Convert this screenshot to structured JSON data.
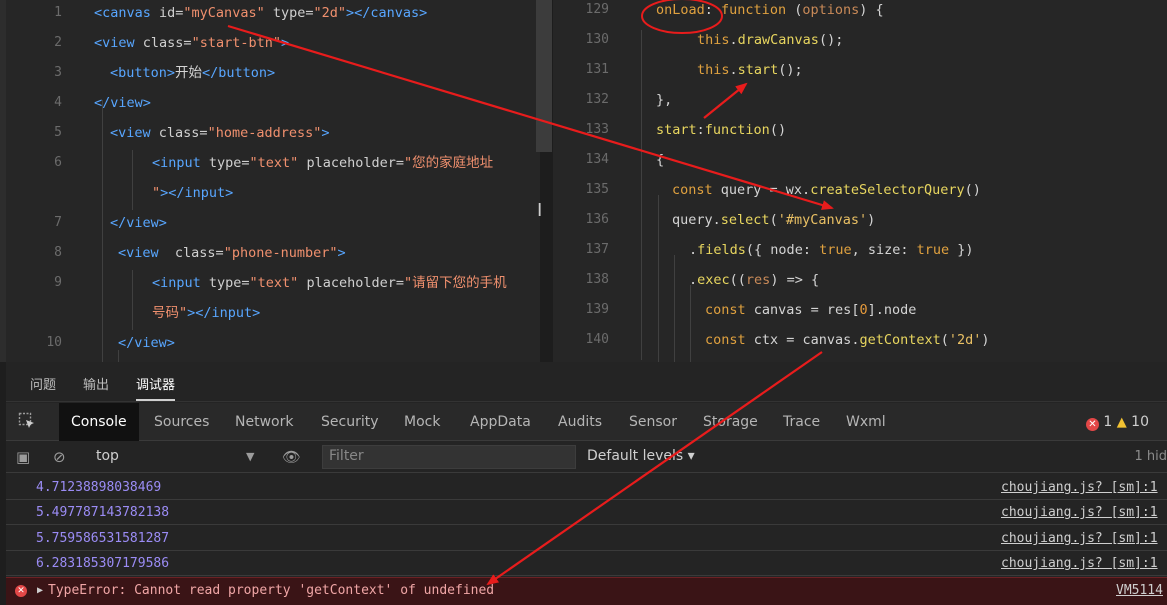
{
  "left_code": {
    "lines": [
      {
        "num": "1",
        "parts": [
          [
            "tag",
            "<canvas "
          ],
          [
            "attr",
            "id="
          ],
          [
            "str",
            "\"myCanvas\""
          ],
          [
            "attr",
            " type="
          ],
          [
            "str",
            "\"2d\""
          ],
          [
            "tag",
            "></canvas>"
          ]
        ]
      },
      {
        "num": "2",
        "parts": [
          [
            "tag",
            "<view "
          ],
          [
            "attr",
            "class="
          ],
          [
            "str",
            "\"start-btn\""
          ],
          [
            "tag",
            ">"
          ]
        ]
      },
      {
        "num": "3",
        "parts": [
          [
            "tag",
            "<button>"
          ],
          [
            "txt",
            "开始"
          ],
          [
            "tag",
            "</button>"
          ]
        ]
      },
      {
        "num": "4",
        "parts": [
          [
            "tag",
            "</view>"
          ]
        ]
      },
      {
        "num": "5",
        "parts": [
          [
            "tag",
            "<view "
          ],
          [
            "attr",
            "class="
          ],
          [
            "str",
            "\"home-address\""
          ],
          [
            "tag",
            ">"
          ]
        ]
      },
      {
        "num": "6",
        "parts": [
          [
            "tag",
            "<input "
          ],
          [
            "attr",
            "type="
          ],
          [
            "str",
            "\"text\""
          ],
          [
            "attr",
            " placeholder="
          ],
          [
            "str",
            "\"您的家庭地址"
          ]
        ]
      },
      {
        "num": "",
        "parts": [
          [
            "str",
            "\""
          ],
          [
            "tag",
            "></input>"
          ]
        ]
      },
      {
        "num": "7",
        "parts": [
          [
            "tag",
            "</view>"
          ]
        ]
      },
      {
        "num": "8",
        "parts": [
          [
            "tag",
            "<view  "
          ],
          [
            "attr",
            "class="
          ],
          [
            "str",
            "\"phone-number\""
          ],
          [
            "tag",
            ">"
          ]
        ]
      },
      {
        "num": "9",
        "parts": [
          [
            "tag",
            "<input "
          ],
          [
            "attr",
            "type="
          ],
          [
            "str",
            "\"text\""
          ],
          [
            "attr",
            " placeholder="
          ],
          [
            "str",
            "\"请留下您的手机"
          ]
        ]
      },
      {
        "num": "",
        "parts": [
          [
            "str",
            "号码\""
          ],
          [
            "tag",
            "></input>"
          ]
        ]
      },
      {
        "num": "10",
        "parts": [
          [
            "tag",
            "</view>"
          ]
        ]
      }
    ]
  },
  "right_code": {
    "lines": [
      {
        "num": "129",
        "parts": [
          [
            "kw",
            "onLoad"
          ],
          [
            "punc",
            ": "
          ],
          [
            "kw",
            "function"
          ],
          [
            "punc",
            " ("
          ],
          [
            "param",
            "options"
          ],
          [
            "punc",
            ") {"
          ]
        ]
      },
      {
        "num": "130",
        "parts": [
          [
            "kw",
            "this"
          ],
          [
            "punc",
            "."
          ],
          [
            "fn",
            "drawCanvas"
          ],
          [
            "punc",
            "();"
          ]
        ]
      },
      {
        "num": "131",
        "parts": [
          [
            "kw",
            "this"
          ],
          [
            "punc",
            "."
          ],
          [
            "fn",
            "start"
          ],
          [
            "punc",
            "();"
          ]
        ]
      },
      {
        "num": "132",
        "parts": [
          [
            "punc",
            "},"
          ]
        ]
      },
      {
        "num": "133",
        "parts": [
          [
            "fn",
            "start"
          ],
          [
            "punc",
            ":"
          ],
          [
            "fn",
            "function"
          ],
          [
            "punc",
            "()"
          ]
        ]
      },
      {
        "num": "134",
        "parts": [
          [
            "punc",
            "{"
          ]
        ]
      },
      {
        "num": "135",
        "parts": [
          [
            "kw",
            "const "
          ],
          [
            "prop",
            "query = wx."
          ],
          [
            "fn",
            "createSelectorQuery"
          ],
          [
            "punc",
            "()"
          ]
        ]
      },
      {
        "num": "136",
        "parts": [
          [
            "prop",
            "query."
          ],
          [
            "fn",
            "select"
          ],
          [
            "punc",
            "("
          ],
          [
            "strjs",
            "'#myCanvas'"
          ],
          [
            "punc",
            ")"
          ]
        ]
      },
      {
        "num": "137",
        "parts": [
          [
            "punc",
            "."
          ],
          [
            "fn",
            "fields"
          ],
          [
            "punc",
            "({ node: "
          ],
          [
            "kw",
            "true"
          ],
          [
            "punc",
            ", size: "
          ],
          [
            "kw",
            "true"
          ],
          [
            "punc",
            " })"
          ]
        ]
      },
      {
        "num": "138",
        "parts": [
          [
            "punc",
            "."
          ],
          [
            "fn",
            "exec"
          ],
          [
            "punc",
            "(("
          ],
          [
            "param",
            "res"
          ],
          [
            "punc",
            ") => {"
          ]
        ]
      },
      {
        "num": "139",
        "parts": [
          [
            "kw",
            "const "
          ],
          [
            "prop",
            "canvas = res["
          ],
          [
            "num",
            "0"
          ],
          [
            "prop",
            "].node"
          ]
        ]
      },
      {
        "num": "140",
        "parts": [
          [
            "kw",
            "const "
          ],
          [
            "prop",
            "ctx = canvas."
          ],
          [
            "fn",
            "getContext"
          ],
          [
            "punc",
            "("
          ],
          [
            "strjs",
            "'2d'"
          ],
          [
            "punc",
            ")"
          ]
        ]
      }
    ]
  },
  "devtools": {
    "panel_tabs": [
      "问题",
      "输出",
      "调试器"
    ],
    "tool_tabs": [
      "Console",
      "Sources",
      "Network",
      "Security",
      "Mock",
      "AppData",
      "Audits",
      "Sensor",
      "Storage",
      "Trace",
      "Wxml"
    ],
    "error_count": "1",
    "warning_count": "10",
    "context": "top",
    "filter_placeholder": "Filter",
    "levels": "Default levels",
    "hidden": "1 hid",
    "logs": [
      {
        "value": "4.71238898038469",
        "source": "choujiang.js? [sm]:1"
      },
      {
        "value": "5.497787143782138",
        "source": "choujiang.js? [sm]:1"
      },
      {
        "value": "5.759586531581287",
        "source": "choujiang.js? [sm]:1"
      },
      {
        "value": "6.283185307179586",
        "source": "choujiang.js? [sm]:1"
      }
    ],
    "error": {
      "text": "TypeError: Cannot read property 'getContext' of undefined",
      "source": "VM5114"
    }
  }
}
